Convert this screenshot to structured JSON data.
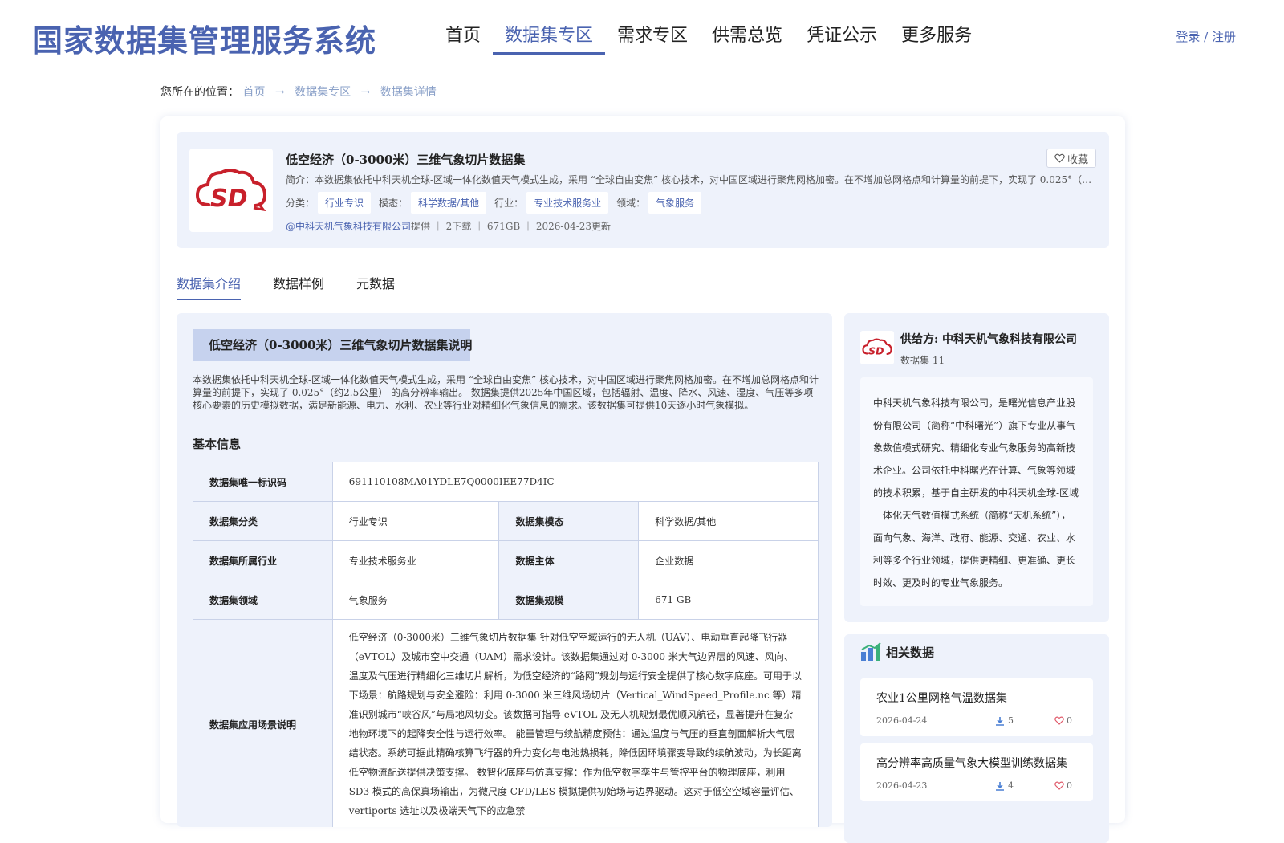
{
  "header": {
    "logo": "国家数据集管理服务系统",
    "nav": [
      "首页",
      "数据集专区",
      "需求专区",
      "供需总览",
      "凭证公示",
      "更多服务"
    ],
    "active_nav": "数据集专区",
    "login": "登录 / 注册"
  },
  "breadcrumb": {
    "prefix": "您所在的位置：",
    "items": [
      "首页",
      "数据集专区",
      "数据集详情"
    ],
    "arrow": "→"
  },
  "dataset": {
    "title": "低空经济（0-3000米）三维气象切片数据集",
    "summary": "简介：本数据集依托中科天机全球-区域一体化数值天气模式生成，采用 “全球自由变焦” 核心技术，对中国区域进行聚焦网格加密。在不增加总网格点和计算量的前提下，实现了 0.025°（约…",
    "labels": {
      "category": "分类：",
      "modality": "模态：",
      "industry": "行业：",
      "domain": "领域："
    },
    "category": "行业专识",
    "modality": "科学数据/其他",
    "industry": "专业技术服务业",
    "domain": "气象服务",
    "provider_link": "@中科天机气象科技有限公司",
    "provider_meta": "提供 ｜ 2下载 ｜ 671GB ｜ 2026-04-23更新",
    "favorite": "收藏"
  },
  "tabs": [
    "数据集介绍",
    "数据样例",
    "元数据"
  ],
  "intro": {
    "heading": "低空经济（0-3000米）三维气象切片数据集说明",
    "description": "本数据集依托中科天机全球-区域一体化数值天气模式生成，采用 “全球自由变焦” 核心技术，对中国区域进行聚焦网格加密。在不增加总网格点和计算量的前提下，实现了 0.025°（约2.5公里） 的高分辨率输出。 数据集提供2025年中国区域，包括辐射、温度、降水、风速、湿度、气压等多项核心要素的历史模拟数据，满足新能源、电力、水利、农业等行业对精细化气象信息的需求。该数据集可提供10天逐小时气象模拟。",
    "basic_title": "基本信息",
    "table": {
      "id_label": "数据集唯一标识码",
      "id_value": "691110108MA01YDLE7Q0000IEE77D4IC",
      "cat_label": "数据集分类",
      "cat_value": "行业专识",
      "mod_label": "数据集模态",
      "mod_value": "科学数据/其他",
      "ind_label": "数据集所属行业",
      "ind_value": "专业技术服务业",
      "subj_label": "数据主体",
      "subj_value": "企业数据",
      "dom_label": "数据集领域",
      "dom_value": "气象服务",
      "size_label": "数据集规模",
      "size_value": "671 GB",
      "scene_label": "数据集应用场景说明",
      "scene_value": "低空经济（0-3000米）三维气象切片数据集 针对低空空域运行的无人机（UAV）、电动垂直起降飞行器（eVTOL）及城市空中交通（UAM）需求设计。该数据集通过对 0-3000 米大气边界层的风速、风向、温度及气压进行精细化三维切片解析，为低空经济的“路网”规划与运行安全提供了核心数字底座。可用于以下场景：航路规划与安全避险：利用 0-3000 米三维风场切片（Vertical_WindSpeed_Profile.nc 等）精准识别城市“峡谷风”与局地风切变。该数据可指导 eVTOL 及无人机规划最优顺风航径，显著提升在复杂地物环境下的起降安全性与运行效率。 能量管理与续航精度预估：通过温度与气压的垂直剖面解析大气层结状态。系统可据此精确核算飞行器的升力变化与电池热损耗，降低因环境骤变导致的续航波动，为长距离低空物流配送提供决策支撑。 数智化底座与仿真支撑：作为低空数字孪生与管控平台的物理底座，利用 SD3 模式的高保真场输出，为微尺度 CFD/LES 模拟提供初始场与边界驱动。这对于低空空域容量评估、 vertiports 选址以及极端天气下的应急禁"
    }
  },
  "provider": {
    "name": "供给方: 中科天机气象科技有限公司",
    "count": "数据集 11",
    "intro": "中科天机气象科技有限公司，是曙光信息产业股份有限公司（简称“中科曙光”）旗下专业从事气象数值模式研究、精细化专业气象服务的高新技术企业。公司依托中科曙光在计算、气象等领域的技术积累，基于自主研发的中科天机全球-区域一体化天气数值模式系统（简称“天机系统”），面向气象、海洋、政府、能源、交通、农业、水利等多个行业领域，提供更精细、更准确、更长时效、更及时的专业气象服务。"
  },
  "related": {
    "title": "相关数据",
    "items": [
      {
        "name": "农业1公里网格气温数据集",
        "date": "2026-04-24",
        "downloads": "5",
        "likes": "0"
      },
      {
        "name": "高分辨率高质量气象大模型训练数据集",
        "date": "2026-04-23",
        "downloads": "4",
        "likes": "0"
      }
    ]
  },
  "colors": {
    "brand": "#4a63b0",
    "panel": "#eef2fb",
    "logo_red": "#c8202b"
  },
  "icons": [
    "sd-logo",
    "heart-icon",
    "download-icon",
    "bar-chart-icon",
    "arrow-right-icon"
  ]
}
